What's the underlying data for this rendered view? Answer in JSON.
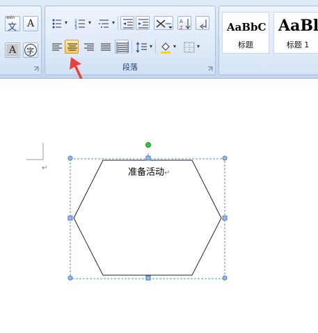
{
  "ribbon": {
    "font_group": {
      "wen_glyph_top": "wén",
      "wen_glyph": "文",
      "a_glyph": "A",
      "char_glyph": "字"
    },
    "paragraph_group": {
      "label": "段落"
    },
    "styles": [
      {
        "sample": "AaBbC",
        "name": "标题"
      },
      {
        "sample": "AaBl",
        "name": "标题 1"
      }
    ]
  },
  "document": {
    "shape_text": "准备活动",
    "paragraph_mark": "↵"
  },
  "colors": {
    "active_button": "#f9c756",
    "arrow": "#e8413c",
    "rotation_handle": "#2ecc40",
    "selection_handle": "#5b8fd6"
  }
}
